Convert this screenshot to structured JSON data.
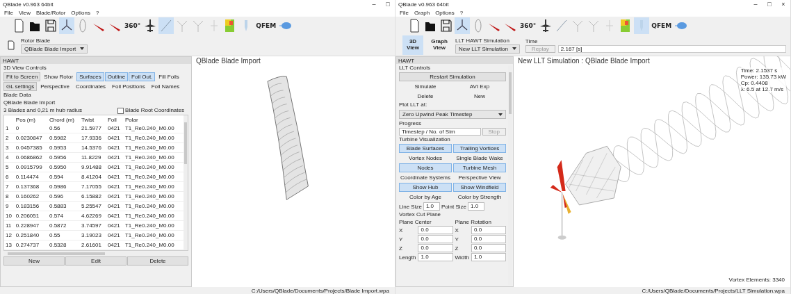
{
  "left_window": {
    "title": "QBlade v0.963 64bit",
    "controls": [
      "–",
      "□"
    ],
    "menu": [
      "File",
      "View",
      "Blade/Rotor",
      "Options",
      "?"
    ],
    "toolbar": [
      {
        "kind": "new",
        "selected": false
      },
      {
        "kind": "open",
        "selected": false
      },
      {
        "kind": "save",
        "selected": false
      },
      {
        "kind": "rotor",
        "selected": true
      },
      {
        "kind": "foil",
        "selected": false
      },
      {
        "kind": "blade",
        "selected": false
      },
      {
        "kind": "blade",
        "selected": false
      },
      {
        "kind": "text",
        "label": "360°",
        "selected": false
      },
      {
        "kind": "turbine",
        "selected": false
      },
      {
        "kind": "line",
        "selected": true
      },
      {
        "kind": "fork",
        "selected": false
      },
      {
        "kind": "fork",
        "selected": false
      },
      {
        "kind": "plus",
        "selected": false
      },
      {
        "kind": "heatmap",
        "selected": false
      },
      {
        "kind": "probe",
        "selected": false
      },
      {
        "kind": "text",
        "label": "QFEM",
        "selected": false
      },
      {
        "kind": "cloud",
        "selected": false
      }
    ],
    "blade_label": "Rotor Blade",
    "blade_select": "QBlade Blade Import",
    "panel": {
      "header": "HAWT",
      "view_controls_title": "3D View Controls",
      "view_buttons": [
        [
          {
            "label": "Fit to Screen",
            "kind": "push",
            "selected": false
          },
          {
            "label": "Show Rotor",
            "kind": "toggle",
            "selected": false
          },
          {
            "label": "Surfaces",
            "kind": "toggle",
            "selected": true
          },
          {
            "label": "Outline",
            "kind": "toggle",
            "selected": true
          },
          {
            "label": "Foil Out.",
            "kind": "toggle",
            "selected": true
          },
          {
            "label": "Fill Foils",
            "kind": "toggle",
            "selected": false
          }
        ],
        [
          {
            "label": "GL settings",
            "kind": "push",
            "selected": false
          },
          {
            "label": "Perspective",
            "kind": "toggle",
            "selected": false
          },
          {
            "label": "Coordinates",
            "kind": "toggle",
            "selected": false
          },
          {
            "label": "Foil Positions",
            "kind": "toggle",
            "selected": false
          },
          {
            "label": "Foil Names",
            "kind": "toggle",
            "selected": false
          }
        ]
      ],
      "blade_data_title": "Blade Data",
      "blade_name": "QBlade Blade Import",
      "blade_info": "3 Blades and 0,21 m hub radius",
      "root_coords": {
        "label": "Blade Root Coordinates",
        "checked": false
      },
      "table": {
        "columns": [
          "Pos (m)",
          "Chord (m)",
          "Twist",
          "Foil",
          "Polar"
        ],
        "rows": [
          {
            "index": "1",
            "cells": [
              "0",
              "0.56",
              "21.5977",
              "0421",
              "T1_Re0.240_M0.00"
            ]
          },
          {
            "index": "2",
            "cells": [
              "0.0230847",
              "0.5982",
              "17.9336",
              "0421",
              "T1_Re0.240_M0.00"
            ]
          },
          {
            "index": "3",
            "cells": [
              "0.0457385",
              "0.5953",
              "14.5376",
              "0421",
              "T1_Re0.240_M0.00"
            ]
          },
          {
            "index": "4",
            "cells": [
              "0.0686862",
              "0.5956",
              "11.8229",
              "0421",
              "T1_Re0.240_M0.00"
            ]
          },
          {
            "index": "5",
            "cells": [
              "0.0915799",
              "0.5950",
              "9.91488",
              "0421",
              "T1_Re0.240_M0.00"
            ]
          },
          {
            "index": "6",
            "cells": [
              "0.114474",
              "0.594",
              "8.41204",
              "0421",
              "T1_Re0.240_M0.00"
            ]
          },
          {
            "index": "7",
            "cells": [
              "0.137368",
              "0.5986",
              "7.17055",
              "0421",
              "T1_Re0.240_M0.00"
            ]
          },
          {
            "index": "8",
            "cells": [
              "0.160262",
              "0.596",
              "6.15882",
              "0421",
              "T1_Re0.240_M0.00"
            ]
          },
          {
            "index": "9",
            "cells": [
              "0.183156",
              "0.5883",
              "5.25547",
              "0421",
              "T1_Re0.240_M0.00"
            ]
          },
          {
            "index": "10",
            "cells": [
              "0.206051",
              "0.574",
              "4.62269",
              "0421",
              "T1_Re0.240_M0.00"
            ]
          },
          {
            "index": "11",
            "cells": [
              "0.228947",
              "0.5872",
              "3.74597",
              "0421",
              "T1_Re0.240_M0.00"
            ]
          },
          {
            "index": "12",
            "cells": [
              "0.251840",
              "0.55",
              "3.19023",
              "0421",
              "T1_Re0.240_M0.00"
            ]
          },
          {
            "index": "13",
            "cells": [
              "0.274737",
              "0.5328",
              "2.61601",
              "0421",
              "T1_Re0.240_M0.00"
            ]
          }
        ]
      },
      "buttons": [
        "New",
        "Edit",
        "Delete"
      ]
    },
    "view_title": "QBlade Blade Import",
    "status": "C:/Users/QBlade/Documents/Projects/Blade Import.wpa"
  },
  "right_window": {
    "title": "QBlade v0.963 64bit",
    "controls": [
      "–",
      "□",
      "×"
    ],
    "menu": [
      "File",
      "Graph",
      "Options",
      "?"
    ],
    "toolbar": [
      {
        "kind": "new",
        "selected": false
      },
      {
        "kind": "open",
        "selected": false
      },
      {
        "kind": "save",
        "selected": false
      },
      {
        "kind": "rotor",
        "selected": true
      },
      {
        "kind": "foil",
        "selected": false
      },
      {
        "kind": "blade",
        "selected": false
      },
      {
        "kind": "blade",
        "selected": false
      },
      {
        "kind": "text",
        "label": "360°",
        "selected": false
      },
      {
        "kind": "turbine",
        "selected": false
      },
      {
        "kind": "line",
        "selected": false
      },
      {
        "kind": "fork",
        "selected": false
      },
      {
        "kind": "fork",
        "selected": false
      },
      {
        "kind": "plus",
        "selected": false
      },
      {
        "kind": "heatmap",
        "selected": false
      },
      {
        "kind": "probe",
        "selected": true
      },
      {
        "kind": "text",
        "label": "QFEM",
        "selected": false
      },
      {
        "kind": "cloud",
        "selected": false
      }
    ],
    "view_toggle": [
      {
        "label": "3D View",
        "selected": true
      },
      {
        "label": "Graph View",
        "selected": false
      }
    ],
    "simulation_label": "LLT HAWT Simulation",
    "simulation_select": "New LLT Simulation",
    "time_label": "Time",
    "replay": {
      "label": "Replay",
      "disabled": true
    },
    "time_value": "2.167 [s]",
    "panel": {
      "header": "HAWT",
      "items": [
        {
          "kind": "section",
          "label": "LLT Controls"
        },
        {
          "kind": "button",
          "label": "Restart Simulation"
        },
        {
          "kind": "pair",
          "buttons": [
            {
              "label": "Simulate",
              "selected": false
            },
            {
              "label": "AVI Exp",
              "selected": false
            }
          ]
        },
        {
          "kind": "pair",
          "buttons": [
            {
              "label": "Delete",
              "selected": false
            },
            {
              "label": "New",
              "selected": false
            }
          ]
        },
        {
          "kind": "section",
          "label": "Plot LLT at:"
        },
        {
          "kind": "select",
          "label": "Zero Upwind Peak Timestep"
        },
        {
          "kind": "section",
          "label": "Progress"
        },
        {
          "kind": "progress",
          "label": "Timestep / No. of Sim",
          "button": "Stop",
          "disabled": true
        },
        {
          "kind": "section",
          "label": "Turbine Visualization"
        },
        {
          "kind": "pair",
          "buttons": [
            {
              "label": "Blade Surfaces",
              "selected": true
            },
            {
              "label": "Trailing Vortices",
              "selected": true
            }
          ]
        },
        {
          "kind": "pair",
          "buttons": [
            {
              "label": "Vortex Nodes",
              "selected": false
            },
            {
              "label": "Single Blade Wake",
              "selected": false
            }
          ]
        },
        {
          "kind": "pair",
          "buttons": [
            {
              "label": "Nodes",
              "selected": true
            },
            {
              "label": "Turbine Mesh",
              "selected": true
            }
          ]
        },
        {
          "kind": "pair",
          "buttons": [
            {
              "label": "Coordinate Systems",
              "selected": false
            },
            {
              "label": "Perspective View",
              "selected": false
            }
          ]
        },
        {
          "kind": "pair",
          "buttons": [
            {
              "label": "Show Hub",
              "selected": true
            },
            {
              "label": "Show Windfield",
              "selected": true
            }
          ]
        },
        {
          "kind": "pair",
          "buttons": [
            {
              "label": "Color by Age",
              "selected": false
            },
            {
              "label": "Color by Strength",
              "selected": false
            }
          ]
        },
        {
          "kind": "sizes",
          "fields": [
            {
              "label": "Line Size",
              "value": "1.0"
            },
            {
              "label": "Point Size",
              "value": "1.0"
            }
          ]
        },
        {
          "kind": "section",
          "label": "Vortex Cut Plane"
        },
        {
          "kind": "grid",
          "headers": [
            "Plane Center",
            "Plane Rotation"
          ],
          "rows": [
            [
              "X",
              "0.0",
              "X",
              "0.0"
            ],
            [
              "Y",
              "0.0",
              "Y",
              "0.0"
            ],
            [
              "Z",
              "0.0",
              "Z",
              "0.0"
            ],
            [
              "Length",
              "1.0",
              "Width",
              "1.0"
            ]
          ]
        }
      ]
    },
    "view_title": "New LLT Simulation : QBlade Blade Import",
    "readout": [
      "Time: 2.1537 s",
      "Power: 135.73 kW",
      "Cp: 0.4408",
      "λ: 6.5 at 12.7 m/s"
    ],
    "elements": "Vortex Elements: 3340",
    "status": "C:/Users/QBlade/Documents/Projects/LLT Simulation.wpa"
  }
}
